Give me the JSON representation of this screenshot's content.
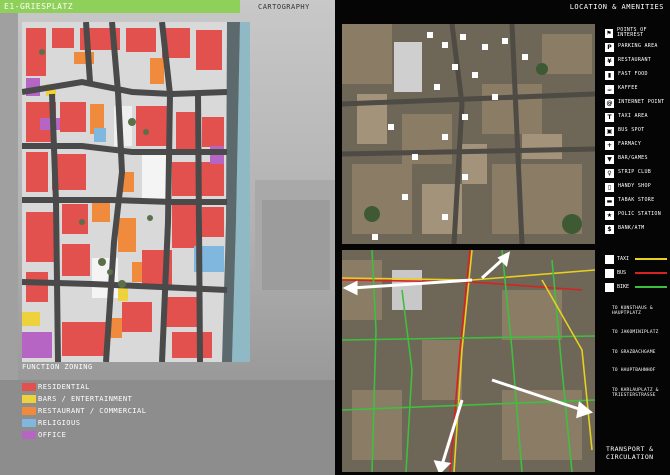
{
  "header": {
    "title": "E1-GRIESPLATZ",
    "subtitle": "CARTOGRAPHY",
    "right_title": "LOCATION & AMENITIES"
  },
  "zoning": {
    "title": "FUNCTION ZONING",
    "legend": [
      {
        "label": "RESIDENTIAL",
        "color": "#e3514f"
      },
      {
        "label": "BARS / ENTERTAINMENT",
        "color": "#eed23c"
      },
      {
        "label": "RESTAURANT / COMMERCIAL",
        "color": "#f08a3c"
      },
      {
        "label": "RELIGIOUS",
        "color": "#7fb7de"
      },
      {
        "label": "OFFICE",
        "color": "#b665c4"
      }
    ]
  },
  "amenities": [
    {
      "label": "POINTS OF INTEREST",
      "icon": "flag-icon",
      "glyph": "⚑"
    },
    {
      "label": "PARKING AREA",
      "icon": "parking-icon",
      "glyph": "P"
    },
    {
      "label": "RESTAURANT",
      "icon": "cutlery-icon",
      "glyph": "¥"
    },
    {
      "label": "FAST FOOD",
      "icon": "fast-food-icon",
      "glyph": "▮"
    },
    {
      "label": "KAFFEE",
      "icon": "coffee-icon",
      "glyph": "☕"
    },
    {
      "label": "INTERNET POINT",
      "icon": "internet-icon",
      "glyph": "@"
    },
    {
      "label": "TAXI AREA",
      "icon": "taxi-icon",
      "glyph": "T"
    },
    {
      "label": "BUS SPOT",
      "icon": "bus-icon",
      "glyph": "▣"
    },
    {
      "label": "FARMACY",
      "icon": "pharmacy-cross-icon",
      "glyph": "+"
    },
    {
      "label": "BAR/GAMES",
      "icon": "bar-icon",
      "glyph": "▼"
    },
    {
      "label": "STRIP CLUB",
      "icon": "strip-club-icon",
      "glyph": "♀"
    },
    {
      "label": "HANDY SHOP",
      "icon": "phone-icon",
      "glyph": "▯"
    },
    {
      "label": "TABAK STORE",
      "icon": "tobacco-icon",
      "glyph": "▬"
    },
    {
      "label": "POLIC STATION",
      "icon": "police-icon",
      "glyph": "★"
    },
    {
      "label": "BANK/ATM",
      "icon": "bank-icon",
      "glyph": "$"
    }
  ],
  "transport": {
    "title": "TRANSPORT & CIRCULATION",
    "legend": [
      {
        "label": "TAXI",
        "color": "#e8d020",
        "icon": "taxi-icon"
      },
      {
        "label": "BUS",
        "color": "#d82222",
        "icon": "bus-icon"
      },
      {
        "label": "BIKE",
        "color": "#3fbf3f",
        "icon": "bike-icon"
      }
    ],
    "destinations": [
      "TO KUNSTHAUS & HAUPTPLATZ",
      "TO JAKOMINIPLATZ",
      "TO GRAZBACHGAME",
      "TO HAUPTBAHNHOF",
      "TO KARLAUPLATZ & TRIESTERSTRASSE"
    ]
  }
}
